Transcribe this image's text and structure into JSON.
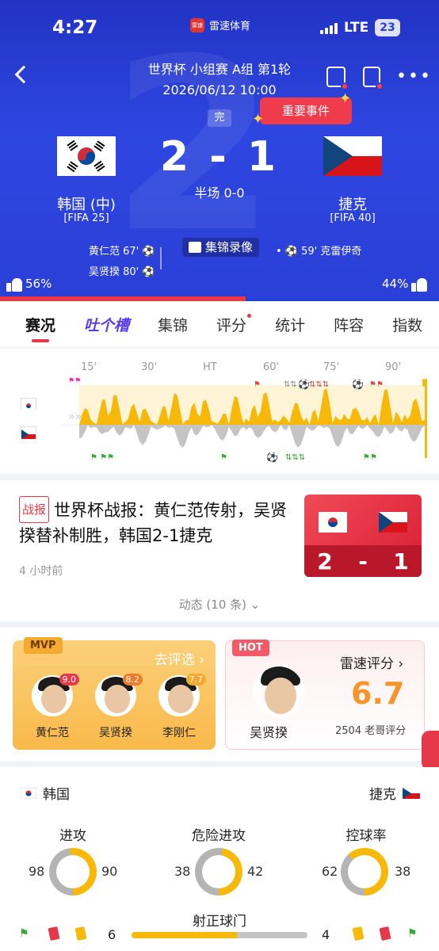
{
  "status_bar": {
    "time": "4:27",
    "app_name": "雷速体育",
    "network": "LTE",
    "battery": "23"
  },
  "match": {
    "title": "世界杯 小组赛 A组 第1轮",
    "datetime": "2026/06/12 10:00",
    "status": "完",
    "important_events_label": "重要事件",
    "score": "2 - 1",
    "halftime": "半场 0-0",
    "home": {
      "name": "韩国 (中)",
      "rank": "[FIFA 25]",
      "support": "56%",
      "support_value": 0.56
    },
    "away": {
      "name": "捷克",
      "rank": "[FIFA 40]",
      "support": "44%"
    },
    "home_events": [
      "黄仁范 67'",
      "吴贤揆 80'"
    ],
    "away_events": [
      "59' 克雷伊奇"
    ],
    "highlights_label": "集锦录像"
  },
  "tabs": [
    "赛况",
    "吐个槽",
    "集锦",
    "评分",
    "统计",
    "阵容",
    "指数"
  ],
  "timeline": {
    "ticks": [
      "15'",
      "30'",
      "HT",
      "60'",
      "75'",
      "90'"
    ]
  },
  "news": {
    "tag": "战报",
    "title": "世界杯战报：黄仁范传射，吴贤揆替补制胜，韩国2-1捷克",
    "time": "4 小时前",
    "card_score_home": "2",
    "card_score_sep": "-",
    "card_score_away": "1",
    "more": "动态 (10 条)"
  },
  "mvp": {
    "tag": "MVP",
    "action": "去评选",
    "players": [
      {
        "name": "黄仁范",
        "rating": "9.0",
        "color": "#e5394a"
      },
      {
        "name": "吴贤揆",
        "rating": "8.2",
        "color": "#f07a2a"
      },
      {
        "name": "李刚仁",
        "rating": "7.7",
        "color": "#f6a92f"
      }
    ]
  },
  "rating": {
    "tag": "HOT",
    "title": "雷速评分",
    "player": "吴贤揆",
    "score": "6.7",
    "count": "2504 老哥评分"
  },
  "stats": {
    "home_team": "韩国",
    "away_team": "捷克",
    "items": [
      {
        "label": "进攻",
        "home": "98",
        "away": "90",
        "home_value": 98,
        "away_value": 90
      },
      {
        "label": "危险进攻",
        "home": "38",
        "away": "42",
        "home_value": 38,
        "away_value": 42
      },
      {
        "label": "控球率",
        "home": "62",
        "away": "38",
        "home_value": 62,
        "away_value": 38
      }
    ],
    "shots_on_target": {
      "label": "射正球门",
      "home": "6",
      "away": "4",
      "home_value": 6,
      "away_value": 4
    }
  },
  "colors": {
    "home": "#f6b90a",
    "away": "#b4b4b4",
    "accent": "#e5394a",
    "hero": "#2a3fd6"
  }
}
